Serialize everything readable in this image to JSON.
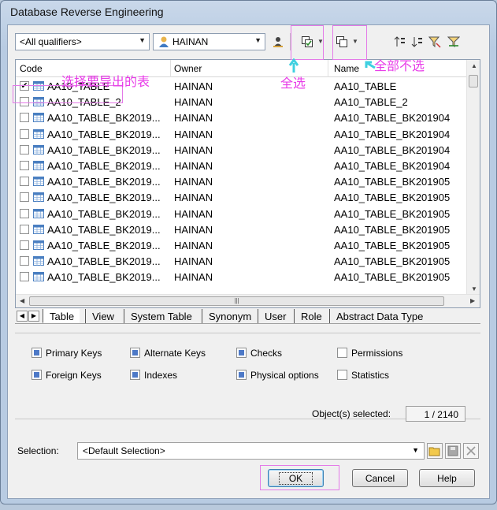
{
  "window": {
    "title": "Database Reverse Engineering"
  },
  "toolbar": {
    "qualifier": "<All qualifiers>",
    "owner": "HAINAN",
    "icons": [
      "owner-filter-icon",
      "select-all-icon",
      "deselect-all-icon",
      "sort-icon",
      "sort-desc-icon",
      "filter-icon",
      "clear-filter-icon"
    ]
  },
  "annotations": {
    "select_table": "选择要导出的表",
    "select_all": "全选",
    "deselect_all": "全部不选"
  },
  "table": {
    "headers": [
      "Code",
      "Owner",
      "Name"
    ],
    "rows": [
      {
        "code": "AA10_TABLE",
        "owner": "HAINAN",
        "name": "AA10_TABLE",
        "checked": "✔"
      },
      {
        "code": "AA10_TABLE_2",
        "owner": "HAINAN",
        "name": "AA10_TABLE_2",
        "checked": ""
      },
      {
        "code": "AA10_TABLE_BK2019...",
        "owner": "HAINAN",
        "name": "AA10_TABLE_BK201904",
        "checked": ""
      },
      {
        "code": "AA10_TABLE_BK2019...",
        "owner": "HAINAN",
        "name": "AA10_TABLE_BK201904",
        "checked": ""
      },
      {
        "code": "AA10_TABLE_BK2019...",
        "owner": "HAINAN",
        "name": "AA10_TABLE_BK201904",
        "checked": ""
      },
      {
        "code": "AA10_TABLE_BK2019...",
        "owner": "HAINAN",
        "name": "AA10_TABLE_BK201904",
        "checked": ""
      },
      {
        "code": "AA10_TABLE_BK2019...",
        "owner": "HAINAN",
        "name": "AA10_TABLE_BK201905",
        "checked": ""
      },
      {
        "code": "AA10_TABLE_BK2019...",
        "owner": "HAINAN",
        "name": "AA10_TABLE_BK201905",
        "checked": ""
      },
      {
        "code": "AA10_TABLE_BK2019...",
        "owner": "HAINAN",
        "name": "AA10_TABLE_BK201905",
        "checked": ""
      },
      {
        "code": "AA10_TABLE_BK2019...",
        "owner": "HAINAN",
        "name": "AA10_TABLE_BK201905",
        "checked": ""
      },
      {
        "code": "AA10_TABLE_BK2019...",
        "owner": "HAINAN",
        "name": "AA10_TABLE_BK201905",
        "checked": ""
      },
      {
        "code": "AA10_TABLE_BK2019...",
        "owner": "HAINAN",
        "name": "AA10_TABLE_BK201905",
        "checked": ""
      },
      {
        "code": "AA10_TABLE_BK2019...",
        "owner": "HAINAN",
        "name": "AA10_TABLE_BK201905",
        "checked": ""
      }
    ]
  },
  "tabs": [
    "Table",
    "View",
    "System Table",
    "Synonym",
    "User",
    "Role",
    "Abstract Data Type"
  ],
  "options": [
    {
      "label": "Primary Keys",
      "checked": true
    },
    {
      "label": "Alternate Keys",
      "checked": true
    },
    {
      "label": "Checks",
      "checked": true
    },
    {
      "label": "Permissions",
      "checked": false
    },
    {
      "label": "Foreign Keys",
      "checked": true
    },
    {
      "label": "Indexes",
      "checked": true
    },
    {
      "label": "Physical options",
      "checked": true
    },
    {
      "label": "Statistics",
      "checked": false
    }
  ],
  "objects_selected": {
    "label": "Object(s) selected:",
    "value": "1 / 2140"
  },
  "selection": {
    "label": "Selection:",
    "value": "<Default Selection>"
  },
  "buttons": {
    "ok": "OK",
    "cancel": "Cancel",
    "help": "Help"
  },
  "colors": {
    "annotation": "#e83ce8",
    "accent": "#4d79c7",
    "frame": "#b8cbe2"
  }
}
